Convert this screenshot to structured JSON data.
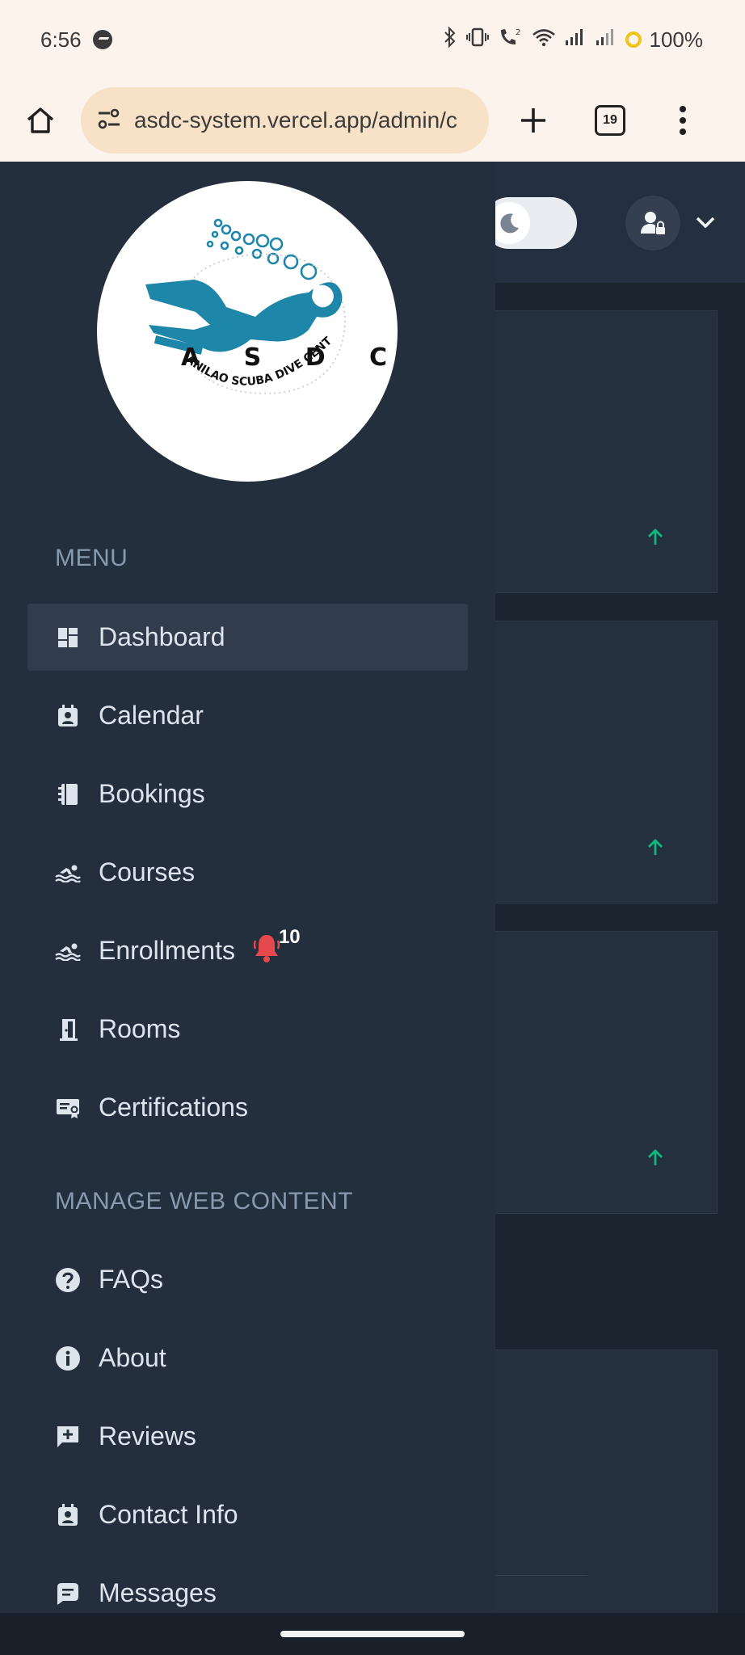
{
  "status_bar": {
    "time": "6:56",
    "battery": "100%",
    "icons": [
      "messenger-icon",
      "bluetooth-icon",
      "vibrate-icon",
      "wifi-call-icon",
      "wifi-icon",
      "signal-icon",
      "signal-icon",
      "battery-saver-icon"
    ]
  },
  "browser": {
    "url": "asdc-system.vercel.app/admin/c",
    "tab_count": "19",
    "icons": [
      "home-icon",
      "site-settings-icon",
      "plus-icon",
      "tabs-icon",
      "kebab-menu-icon"
    ]
  },
  "topbar": {
    "icons": [
      "moon-icon",
      "user-icon",
      "chevron-down-icon"
    ]
  },
  "logo": {
    "letters": "A S D C",
    "subtitle": "ANILAO SCUBA DIVE CENTER",
    "diver_color": "#1e86a8"
  },
  "sidebar": {
    "menu_heading": "MENU",
    "menu_items": [
      {
        "label": "Dashboard",
        "icon": "dashboard-icon",
        "active": true
      },
      {
        "label": "Calendar",
        "icon": "calendar-icon"
      },
      {
        "label": "Bookings",
        "icon": "bookings-icon"
      },
      {
        "label": "Courses",
        "icon": "swimming-icon"
      },
      {
        "label": "Enrollments",
        "icon": "swimming-icon",
        "badge": "10",
        "badge_icon": "bell-icon"
      },
      {
        "label": "Rooms",
        "icon": "door-icon"
      },
      {
        "label": "Certifications",
        "icon": "certificate-icon"
      }
    ],
    "web_heading": "MANAGE WEB CONTENT",
    "web_items": [
      {
        "label": "FAQs",
        "icon": "question-icon"
      },
      {
        "label": "About",
        "icon": "info-icon"
      },
      {
        "label": "Reviews",
        "icon": "review-icon"
      },
      {
        "label": "Contact Info",
        "icon": "contact-icon"
      },
      {
        "label": "Messages",
        "icon": "message-icon"
      }
    ]
  },
  "colors": {
    "sidebar_bg": "#242f3e",
    "active_item_bg": "#313d4d",
    "heading_text": "#8a9aae",
    "item_text": "#dee4ec",
    "badge_bell": "#e5484d",
    "trend_up": "#10b981",
    "browser_bg": "#fcf3ec",
    "url_pill": "#f7e2c8"
  }
}
